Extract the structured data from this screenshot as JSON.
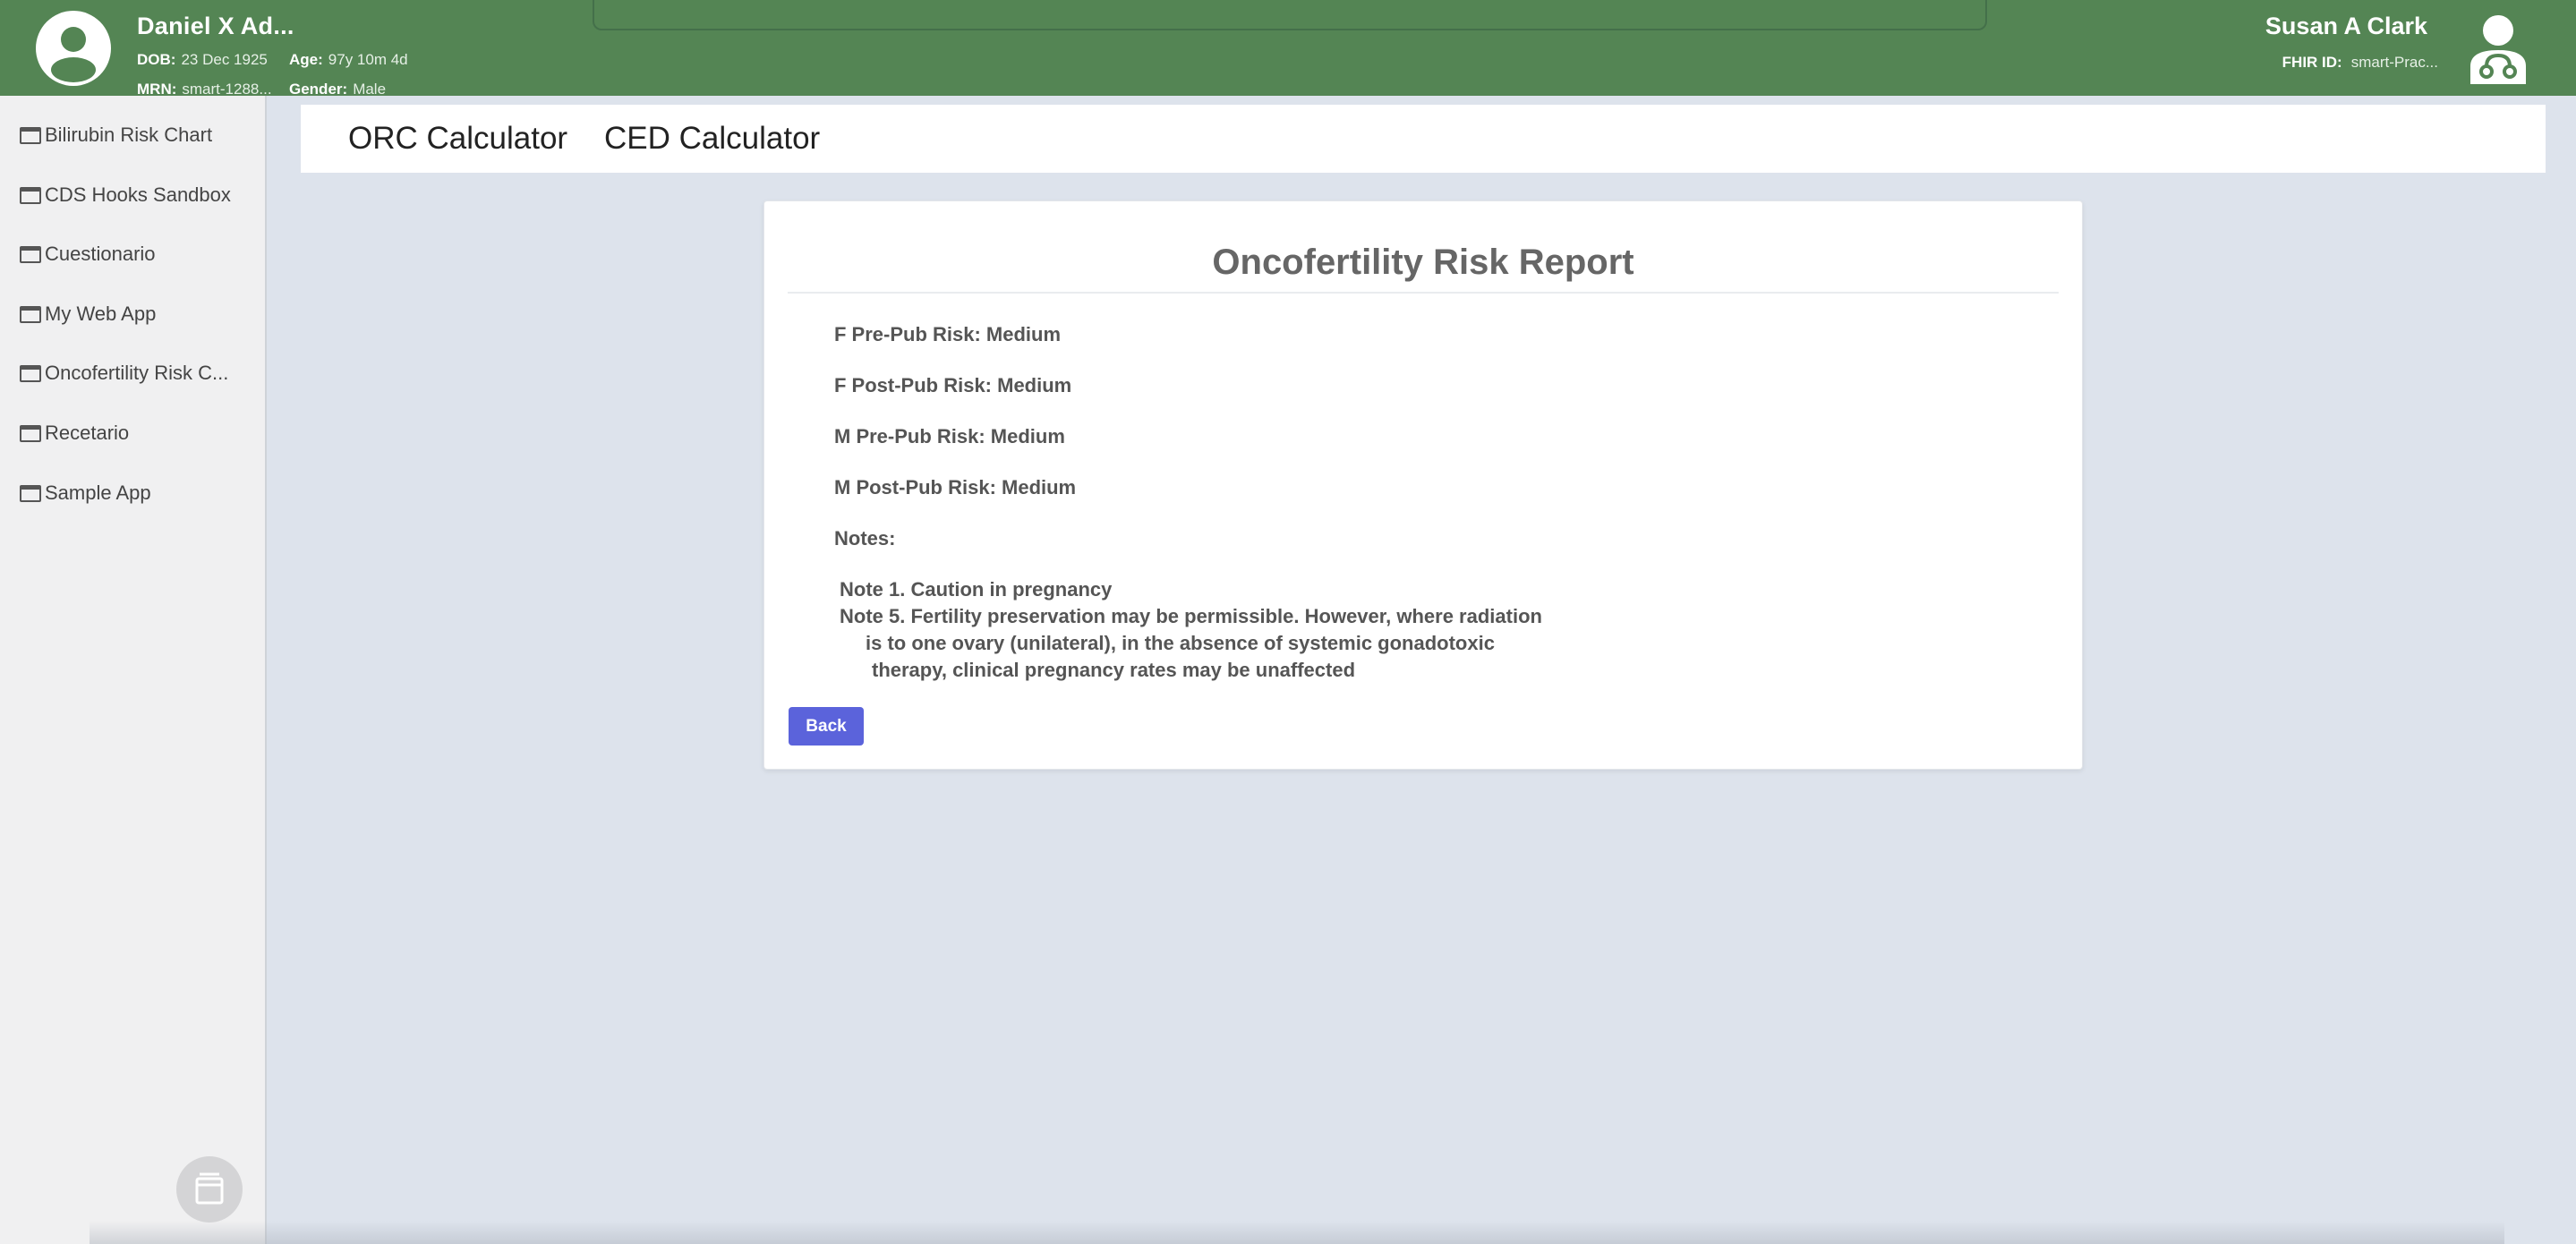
{
  "patient": {
    "name": "Daniel X Ad...",
    "dob_label": "DOB:",
    "dob": "23 Dec 1925",
    "age_label": "Age:",
    "age": "97y 10m 4d",
    "mrn_label": "MRN:",
    "mrn": "smart-1288...",
    "gender_label": "Gender:",
    "gender": "Male"
  },
  "practitioner": {
    "name": "Susan A Clark",
    "fhir_label": "FHIR ID:",
    "fhir_id": "smart-Prac..."
  },
  "sidebar": {
    "items": [
      {
        "label": "Bilirubin Risk Chart"
      },
      {
        "label": "CDS Hooks Sandbox"
      },
      {
        "label": "Cuestionario"
      },
      {
        "label": "My Web App"
      },
      {
        "label": "Oncofertility Risk C..."
      },
      {
        "label": "Recetario"
      },
      {
        "label": "Sample App"
      }
    ]
  },
  "nav": {
    "links": [
      {
        "label": "ORC Calculator"
      },
      {
        "label": "CED Calculator"
      }
    ]
  },
  "report": {
    "title": "Oncofertility Risk Report",
    "risks": [
      "F Pre-Pub Risk: Medium",
      "F Post-Pub Risk: Medium",
      "M Pre-Pub Risk: Medium",
      "M Post-Pub Risk: Medium"
    ],
    "notes_label": "Notes:",
    "notes": [
      "Note 1. Caution in pregnancy",
      "Note 5. Fertility preservation may be permissible. However, where radiation",
      "is to one ovary (unilateral), in the absence of systemic gonadotoxic",
      "therapy, clinical pregnancy rates may be unaffected"
    ],
    "back_label": "Back"
  },
  "colors": {
    "header": "#548554",
    "accent_button": "#5b63db",
    "background": "#dde3ec"
  }
}
